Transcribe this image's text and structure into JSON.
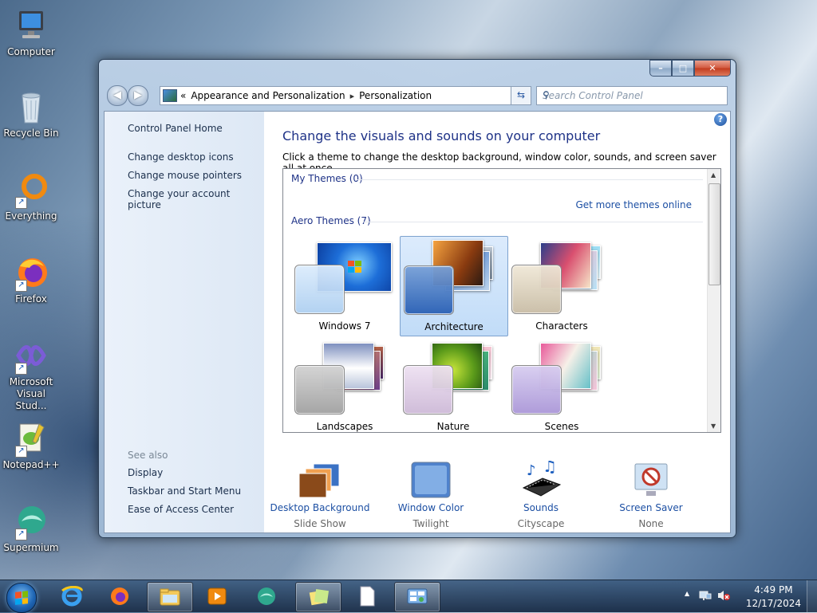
{
  "desktop": {
    "icons": [
      {
        "label": "Computer"
      },
      {
        "label": "Recycle Bin"
      },
      {
        "label": "Everything"
      },
      {
        "label": "Firefox"
      },
      {
        "label": "Microsoft Visual Stud..."
      },
      {
        "label": "Notepad++"
      },
      {
        "label": "Supermium"
      }
    ]
  },
  "window": {
    "controls": {
      "minimize": "–",
      "maximize": "□",
      "close": "✕"
    },
    "nav": {
      "back": "◀",
      "forward": "▶"
    },
    "address": {
      "prefix": "«",
      "crumbs": [
        "Appearance and Personalization",
        "Personalization"
      ],
      "separator": "▸"
    },
    "search": {
      "placeholder": "Search Control Panel"
    },
    "left_pane": {
      "home": "Control Panel Home",
      "tasks": [
        "Change desktop icons",
        "Change mouse pointers",
        "Change your account picture"
      ],
      "see_also_title": "See also",
      "see_also": [
        "Display",
        "Taskbar and Start Menu",
        "Ease of Access Center"
      ]
    },
    "main": {
      "heading": "Change the visuals and sounds on your computer",
      "subheading": "Click a theme to change the desktop background, window color, sounds, and screen saver all at once.",
      "my_themes": "My Themes (0)",
      "get_more": "Get more themes online",
      "aero_themes": "Aero Themes (7)",
      "themes": [
        {
          "name": "Windows 7",
          "selected": false
        },
        {
          "name": "Architecture",
          "selected": true
        },
        {
          "name": "Characters",
          "selected": false
        },
        {
          "name": "Landscapes",
          "selected": false
        },
        {
          "name": "Nature",
          "selected": false
        },
        {
          "name": "Scenes",
          "selected": false
        }
      ]
    },
    "bottom": [
      {
        "name": "Desktop Background",
        "value": "Slide Show"
      },
      {
        "name": "Window Color",
        "value": "Twilight"
      },
      {
        "name": "Sounds",
        "value": "Cityscape"
      },
      {
        "name": "Screen Saver",
        "value": "None"
      }
    ]
  },
  "taskbar": {
    "time": "4:49 PM",
    "date": "12/17/2024",
    "tray_arrow": "▲"
  }
}
